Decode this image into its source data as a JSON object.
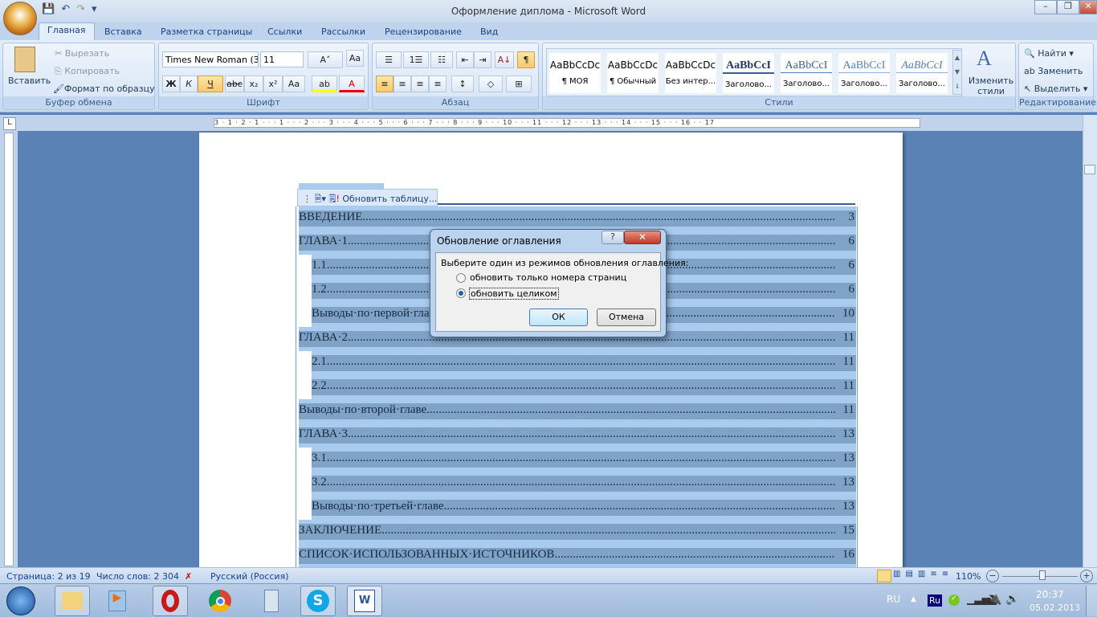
{
  "window": {
    "title": "Оформление диплома - Microsoft Word",
    "minimize": "–",
    "maximize": "❐",
    "close": "✕"
  },
  "qat": {
    "save": "💾",
    "undo": "↶",
    "redo": "↷",
    "more": "▾"
  },
  "tabs": [
    "Главная",
    "Вставка",
    "Разметка страницы",
    "Ссылки",
    "Рассылки",
    "Рецензирование",
    "Вид"
  ],
  "clipboard": {
    "paste": "Вставить",
    "cut": "Вырезать",
    "copy": "Копировать",
    "format_painter": "Формат по образцу",
    "label": "Буфер обмена"
  },
  "font": {
    "name": "Times New Roman (З",
    "size": "11",
    "grow": "A˄",
    "shrink": "A˅",
    "clear": "Aa",
    "bold": "Ж",
    "italic": "К",
    "underline": "Ч",
    "strike": "abc",
    "sub": "x₂",
    "sup": "x²",
    "case": "Aa",
    "highlight": "ab",
    "color": "A",
    "label": "Шрифт"
  },
  "paragraph": {
    "bullets": "☰",
    "numbering": "1☰",
    "multilevel": "☷",
    "dec_indent": "⇤",
    "inc_indent": "⇥",
    "sort": "А↓",
    "pilcrow": "¶",
    "align_left": "≡",
    "center": "≡",
    "right": "≡",
    "justify": "≡",
    "spacing": "↕",
    "shading": "◇",
    "borders": "⊞",
    "label": "Абзац"
  },
  "styles": {
    "items": [
      {
        "sample": "AaBbCcDc",
        "name": "¶ МОЯ"
      },
      {
        "sample": "AaBbCcDc",
        "name": "¶ Обычный"
      },
      {
        "sample": "AaBbCcDc",
        "name": "Без интер..."
      },
      {
        "sample": "AaBbCcI",
        "name": "Заголово..."
      },
      {
        "sample": "AaBbCcI",
        "name": "Заголово..."
      },
      {
        "sample": "AaBbCcI",
        "name": "Заголово..."
      },
      {
        "sample": "AaBbCcI",
        "name": "Заголово..."
      }
    ],
    "change": "Изменить стили",
    "label": "Стили"
  },
  "editing": {
    "find": "Найти",
    "replace": "Заменить",
    "select": "Выделить",
    "label": "Редактирование"
  },
  "ruler": {
    "marks": "3 · 1 · 2 · 1 · · · 1 · · · 2 · · · 3 · · · 4 · · · 5 · · · 6 · · · 7 · · · 8 · · · 9 · · · 10 · · · 11 · · · 12 · · · 13 · · · 14 · · · 15 · · · 16 · · 17"
  },
  "toc_toolbar": {
    "update": "Обновить таблицу..."
  },
  "toc": [
    {
      "text": "ВВЕДЕНИЕ",
      "page": "3",
      "level": 1
    },
    {
      "text": "ГЛАВА·1",
      "page": "6",
      "level": 1
    },
    {
      "text": "1.1",
      "page": "6",
      "level": 2
    },
    {
      "text": "1.2",
      "page": "6",
      "level": 2
    },
    {
      "text": "Выводы·по·первой·главе",
      "page": "10",
      "level": 2
    },
    {
      "text": "ГЛАВА·2",
      "page": "11",
      "level": 1
    },
    {
      "text": "2.1",
      "page": "11",
      "level": 2
    },
    {
      "text": "2.2",
      "page": "11",
      "level": 2
    },
    {
      "text": "Выводы·по·второй·главе",
      "page": "11",
      "level": 1
    },
    {
      "text": "ГЛАВА·3",
      "page": "13",
      "level": 1
    },
    {
      "text": "3.1",
      "page": "13",
      "level": 2
    },
    {
      "text": "3.2",
      "page": "13",
      "level": 2
    },
    {
      "text": "Выводы·по·третьей·главе",
      "page": "13",
      "level": 2
    },
    {
      "text": "ЗАКЛЮЧЕНИЕ",
      "page": "15",
      "level": 1
    },
    {
      "text": "СПИСОК·ИСПОЛЬЗОВАННЫХ·ИСТОЧНИКОВ",
      "page": "16",
      "level": 1
    }
  ],
  "dialog": {
    "title": "Обновление оглавления",
    "help": "?",
    "close": "✕",
    "prompt": "Выберите один из режимов обновления оглавления:",
    "option1": "обновить только номера страниц",
    "option2": "обновить целиком",
    "selected": 2,
    "ok": "ОК",
    "cancel": "Отмена"
  },
  "status": {
    "page": "Страница: 2 из 19",
    "words": "Число слов: 2 304",
    "language": "Русский (Россия)",
    "zoom": "110%",
    "zoom_minus": "−",
    "zoom_plus": "+",
    "zoom_percent": 110
  },
  "tray": {
    "lang": "RU",
    "kbd": "Ru",
    "time": "20:37",
    "date": "05.02.2013"
  }
}
